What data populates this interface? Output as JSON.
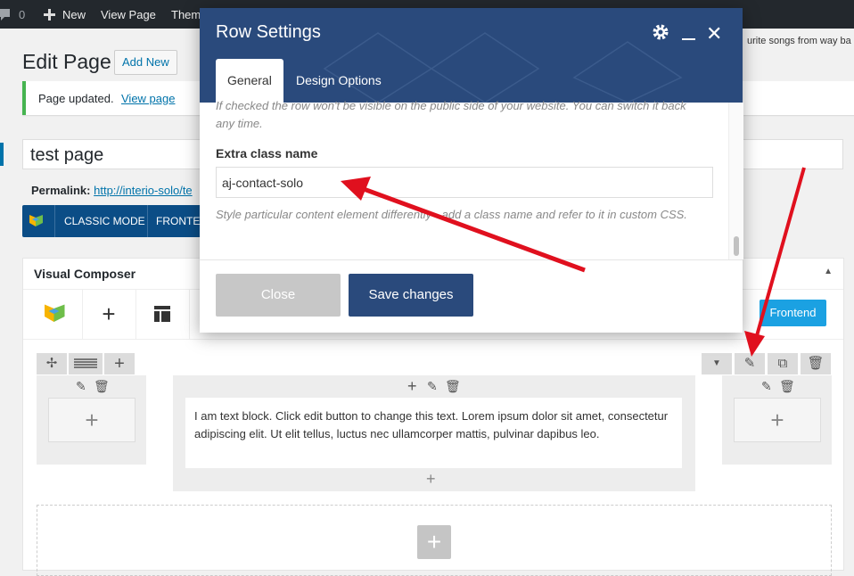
{
  "adminbar": {
    "comments_count": "0",
    "new_label": "New",
    "view_page_label": "View Page",
    "theme_label": "Them",
    "right_text": "urite songs from way ba"
  },
  "header": {
    "title": "Edit Page",
    "add_new_label": "Add New"
  },
  "notice": {
    "text": "Page updated.",
    "link": "View page"
  },
  "editor": {
    "title_value": "test page",
    "permalink_label": "Permalink:",
    "permalink_url": "http://interio-solo/te",
    "classic_mode_label": "CLASSIC MODE",
    "frontend_label": "FRONTEN"
  },
  "vc": {
    "title": "Visual Composer",
    "frontend_button": "Frontend",
    "text_block": "I am text block. Click edit button to change this text. Lorem ipsum dolor sit amet, consectetur adipiscing elit. Ut elit tellus, luctus nec ullamcorper mattis, pulvinar dapibus leo."
  },
  "modal": {
    "title": "Row Settings",
    "tabs": [
      "General",
      "Design Options"
    ],
    "top_help": "If checked the row won't be visible on the public side of your website. You can switch it back any time.",
    "field_label": "Extra class name",
    "field_value": "aj-contact-solo",
    "field_help": "Style particular content element differently - add a class name and refer to it in custom CSS.",
    "close_label": "Close",
    "save_label": "Save changes"
  },
  "colors": {
    "modal_header": "#2a4a7c",
    "arrow": "#e0101e",
    "frontend_button": "#1ba1e2",
    "vc_toolbar": "#0b4d86"
  }
}
